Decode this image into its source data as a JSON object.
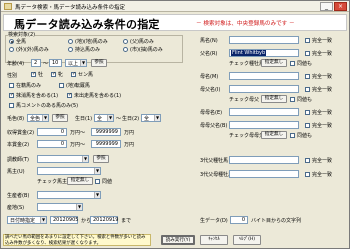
{
  "window": {
    "title": "馬データ検索・馬データ読み込み条件の指定"
  },
  "header": {
    "title": "馬データ読み込み条件の指定",
    "note": "－ 検索対象は、中央登録馬のみです －"
  },
  "left": {
    "search_type": {
      "label": "検索対象(2)",
      "options": [
        "全馬",
        "(外)(外)馬のみ",
        "(地)(地)馬のみ",
        "持込馬のみ",
        "(父)馬のみ",
        "(市)(抽)馬のみ"
      ]
    },
    "age": {
      "label": "年齢(4)",
      "from": "2",
      "to": "10",
      "unit": "以上",
      "btn": "参照"
    },
    "sex": {
      "label": "性別",
      "options": [
        "牡",
        "牝",
        "セン馬"
      ]
    },
    "flags": [
      "在籍馬のみ",
      "(地)転厩馬",
      "抹消馬を含める(1)",
      "未出走馬を含める(1)",
      "馬コメントのある馬のみ(5)"
    ],
    "color": {
      "label": "毛色(8)",
      "value": "全色",
      "btn": "参照"
    },
    "birth": {
      "label": "生日(1)",
      "from": "全",
      "to": "全"
    },
    "prize": {
      "label": "収得賞金(2)",
      "from": "0",
      "mid": "万円～",
      "to": "9999999",
      "unit": "万円"
    },
    "earnings": {
      "label": "本賞金(2)",
      "from": "0",
      "mid": "万円～",
      "to": "9999999",
      "unit": "万円"
    },
    "trainer": {
      "label": "調教師(T)",
      "btn": "参照"
    },
    "owner": {
      "label": "馬主(U)",
      "sub": "チェック馬主",
      "btn": "指定無し",
      "same": "同値"
    },
    "breeder": {
      "label": "生産者(B)"
    },
    "birthplace": {
      "label": "産地(S)"
    },
    "date": {
      "label": "日付時指定",
      "from": "20120905",
      "mid": "から",
      "to": "20120919",
      "end": "まで"
    }
  },
  "right": {
    "rows": [
      {
        "label": "馬名(N)",
        "check": "完全一致"
      },
      {
        "label": "父名(R)",
        "value": "Flint Whitbyb",
        "sub": "チェック種牡馬",
        "btn": "指定無し",
        "check": "完全一致",
        "same": "同値も"
      },
      {
        "label": "母名(M)",
        "check": "完全一致"
      },
      {
        "label": "母父名(I)",
        "sub": "チェック母父",
        "btn": "指定無し",
        "check": "完全一致",
        "same": "同値も"
      },
      {
        "label": "母母名(E)",
        "check": "完全一致"
      },
      {
        "label": "母母父名(B)",
        "sub": "チェック母母父",
        "btn": "指定無し",
        "check": "完全一致",
        "same": "同値も"
      },
      {
        "label": "3代父種牡馬",
        "check": "完全一致"
      },
      {
        "label": "3代父母種牡馬",
        "check": "完全一致"
      }
    ],
    "birthdata": {
      "label": "生データ(D)",
      "value": "0",
      "suffix": "バイト目からの文字列"
    }
  },
  "footer": {
    "info": "調べたい馬の範囲をあまりに設定して下さい。検索と件数が多いと読み込み件数が多くなり、検索結果が遅くなります。",
    "read": "読み実行(Y)",
    "cancel": "ｷｬﾝｾﾙ",
    "help": "ﾍﾙﾌﾟ(H)"
  }
}
